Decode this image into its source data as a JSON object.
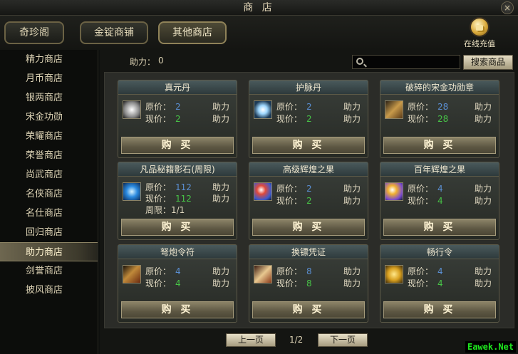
{
  "window": {
    "title": "商  店",
    "close_label": "×"
  },
  "tabs": [
    {
      "label": "奇珍阁"
    },
    {
      "label": "金锭商铺"
    },
    {
      "label": "其他商店"
    }
  ],
  "recharge": {
    "label": "在线充值"
  },
  "sidebar": {
    "items": [
      {
        "label": "精力商店"
      },
      {
        "label": "月币商店"
      },
      {
        "label": "银两商店"
      },
      {
        "label": "宋金功勋"
      },
      {
        "label": "荣耀商店"
      },
      {
        "label": "荣誉商店"
      },
      {
        "label": "尚武商店"
      },
      {
        "label": "名侠商店"
      },
      {
        "label": "名仕商店"
      },
      {
        "label": "回归商店"
      },
      {
        "label": "助力商店"
      },
      {
        "label": "剑誉商店"
      },
      {
        "label": "披风商店"
      }
    ],
    "active_index": 10
  },
  "help": {
    "label": "助力：",
    "value": "0"
  },
  "search": {
    "placeholder": "",
    "button_label": "搜索商品"
  },
  "labels": {
    "orig": "原价：",
    "now": "现价：",
    "currency": "助力",
    "buy": "购 买"
  },
  "items": [
    {
      "name": "真元丹",
      "icon": "dice-icon",
      "orig": "2",
      "now": "2"
    },
    {
      "name": "护脉丹",
      "icon": "glow-orb-icon",
      "orig": "2",
      "now": "2"
    },
    {
      "name": "破碎的宋金功勋章",
      "icon": "broken-medal-icon",
      "orig": "28",
      "now": "28"
    },
    {
      "name": "凡品秘籍影石(周限)",
      "icon": "blue-crystal-icon",
      "orig": "112",
      "now": "112",
      "limit": "周限：1/1"
    },
    {
      "name": "高级辉煌之果",
      "icon": "fruit-icon",
      "orig": "2",
      "now": "2"
    },
    {
      "name": "百年辉煌之果",
      "icon": "fruit-gold-icon",
      "orig": "4",
      "now": "4"
    },
    {
      "name": "弩炮令符",
      "icon": "crossbow-token-icon",
      "orig": "4",
      "now": "4"
    },
    {
      "name": "换镖凭证",
      "icon": "escort-voucher-icon",
      "orig": "8",
      "now": "8"
    },
    {
      "name": "畅行令",
      "icon": "pass-token-icon",
      "orig": "4",
      "now": "4"
    }
  ],
  "pager": {
    "prev": "上一页",
    "next": "下一页",
    "page": "1/2"
  },
  "watermark": "Eawek.Net",
  "colors": {
    "orig_price": "#5a8ed0",
    "now_price": "#47c247",
    "accent": "#8f8258"
  }
}
